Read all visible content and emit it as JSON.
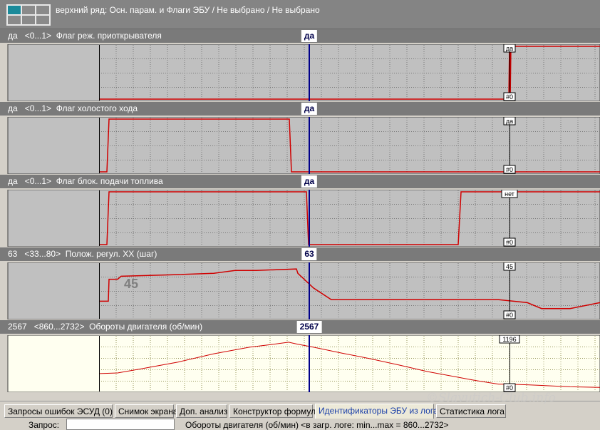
{
  "header": {
    "title": "верхний ряд: Осн. парам. и Флаги ЭБУ / Не выбрано / Не выбрано"
  },
  "colors": {
    "signal": "#d00000",
    "cursor": "#00008b",
    "marker": "#000000",
    "plot_bg": "#c0c0c0",
    "rpm_bg": "#fffff0",
    "grid": "#7a7a7a",
    "accent_tab": "#1a3fa8"
  },
  "panels": [
    {
      "value": "да",
      "range": "<0...1>",
      "name": "Флаг реж. приоткрывателя",
      "cursor_value": "да",
      "marker_top": "да",
      "marker_bottom": "#0",
      "series": [
        [
          140,
          0
        ],
        [
          700,
          0
        ],
        [
          714,
          0
        ],
        [
          715,
          1
        ],
        [
          716,
          1
        ],
        [
          716,
          0
        ],
        [
          717,
          1
        ],
        [
          842,
          1
        ]
      ],
      "ymin": 0,
      "ymax": 1
    },
    {
      "value": "да",
      "range": "<0...1>",
      "name": "Флаг холостого хода",
      "cursor_value": "да",
      "marker_top": "да",
      "marker_bottom": "#0",
      "series": [
        [
          140,
          0
        ],
        [
          150,
          0
        ],
        [
          153,
          1
        ],
        [
          406,
          1
        ],
        [
          409,
          0
        ],
        [
          842,
          0
        ]
      ],
      "ymin": 0,
      "ymax": 1
    },
    {
      "value": "да",
      "range": "<0...1>",
      "name": "Флаг блок. подачи топлива",
      "cursor_value": "да",
      "marker_top": "нет",
      "marker_bottom": "#0",
      "series": [
        [
          140,
          0
        ],
        [
          150,
          0
        ],
        [
          153,
          1
        ],
        [
          430,
          1
        ],
        [
          433,
          0
        ],
        [
          643,
          0
        ],
        [
          647,
          1
        ],
        [
          842,
          1
        ]
      ],
      "ymin": 0,
      "ymax": 1
    },
    {
      "value": "63",
      "range": "<33...80>",
      "name": "Полож. регул. XX (шаг)",
      "cursor_value": "63",
      "marker_top": "45",
      "marker_bottom": "#0",
      "overlay_value": "45",
      "series": [
        [
          140,
          41
        ],
        [
          152,
          41
        ],
        [
          153,
          56
        ],
        [
          165,
          56
        ],
        [
          170,
          58
        ],
        [
          240,
          59
        ],
        [
          300,
          60
        ],
        [
          330,
          62
        ],
        [
          360,
          62
        ],
        [
          416,
          63
        ],
        [
          418,
          60
        ],
        [
          440,
          50
        ],
        [
          465,
          42
        ],
        [
          700,
          42
        ],
        [
          740,
          40
        ],
        [
          760,
          36
        ],
        [
          800,
          36
        ],
        [
          842,
          40
        ]
      ],
      "ymin": 30,
      "ymax": 66
    },
    {
      "value": "2567",
      "range": "<860...2732>",
      "name": "Обороты двигателя (об/мин)",
      "cursor_value": "2567",
      "marker_top": "1196",
      "marker_bottom": "#0",
      "series": [
        [
          140,
          1700
        ],
        [
          165,
          1720
        ],
        [
          200,
          1850
        ],
        [
          250,
          2050
        ],
        [
          300,
          2300
        ],
        [
          350,
          2500
        ],
        [
          380,
          2580
        ],
        [
          405,
          2650
        ],
        [
          418,
          2590
        ],
        [
          440,
          2500
        ],
        [
          480,
          2320
        ],
        [
          520,
          2150
        ],
        [
          560,
          1960
        ],
        [
          600,
          1760
        ],
        [
          640,
          1600
        ],
        [
          660,
          1520
        ],
        [
          670,
          1480
        ],
        [
          700,
          1380
        ],
        [
          714,
          1380
        ],
        [
          740,
          1360
        ],
        [
          800,
          1300
        ],
        [
          842,
          1280
        ]
      ],
      "ymin": 1200,
      "ymax": 2800
    }
  ],
  "tabs": [
    {
      "label": "Запросы ошибок ЭСУД (0)"
    },
    {
      "label": "Снимок экрана"
    },
    {
      "label": "Доп. анализ"
    },
    {
      "label": "Конструктор формул"
    },
    {
      "label": "Идентификаторы ЭБУ из лога"
    },
    {
      "label": "Статистика лога"
    }
  ],
  "status": {
    "label": "Запрос:",
    "info": "Обороты двигателя (об/мин) <в загр. логе: min...max = 860...2732>"
  },
  "watermark": "©Slavutich-Club.info"
}
